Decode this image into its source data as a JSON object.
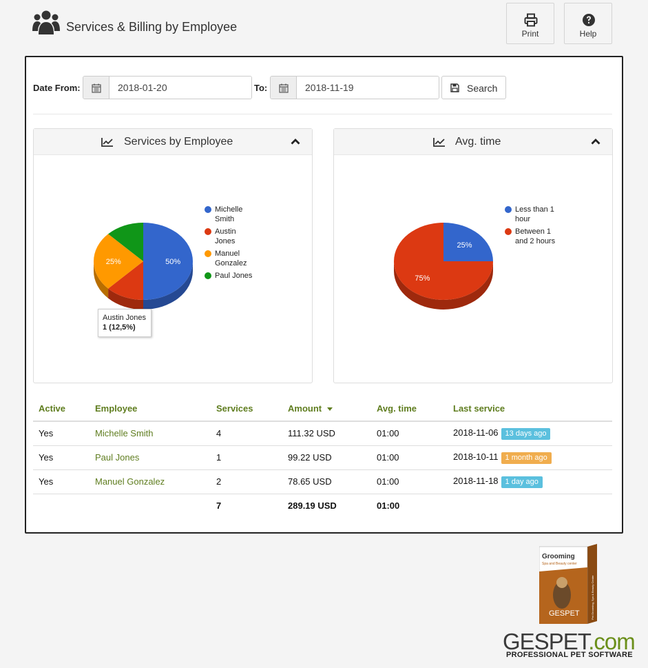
{
  "header": {
    "title": "Services & Billing by Employee",
    "print_label": "Print",
    "help_label": "Help"
  },
  "filters": {
    "date_from_label": "Date From:",
    "date_from_value": "2018-01-20",
    "date_to_label": "To:",
    "date_to_value": "2018-11-19",
    "search_label": "Search"
  },
  "box1": {
    "title": "Services by Employee",
    "legend": [
      "Michelle Smith",
      "Austin Jones",
      "Manuel Gonzalez",
      "Paul Jones"
    ],
    "tooltip_name": "Austin Jones",
    "tooltip_value": "1 (12,5%)"
  },
  "box2": {
    "title": "Avg. time",
    "legend": [
      "Less than 1 hour",
      "Between 1 and 2 hours"
    ]
  },
  "chart_data": [
    {
      "type": "pie",
      "title": "Services by Employee",
      "categories": [
        "Michelle Smith",
        "Austin Jones",
        "Manuel Gonzalez",
        "Paul Jones"
      ],
      "values": [
        50,
        12.5,
        25,
        12.5
      ],
      "labels_shown": [
        "50%",
        "",
        "25%",
        ""
      ],
      "colors": [
        "#3366cc",
        "#dc3912",
        "#ff9900",
        "#109618"
      ],
      "legend_position": "right"
    },
    {
      "type": "pie",
      "title": "Avg. time",
      "categories": [
        "Less than 1 hour",
        "Between 1 and 2 hours"
      ],
      "values": [
        25,
        75
      ],
      "labels_shown": [
        "25%",
        "75%"
      ],
      "colors": [
        "#3366cc",
        "#dc3912"
      ],
      "legend_position": "right"
    }
  ],
  "table": {
    "headers": {
      "active": "Active",
      "employee": "Employee",
      "services": "Services",
      "amount": "Amount",
      "avg_time": "Avg. time",
      "last_service": "Last service"
    },
    "rows": [
      {
        "active": "Yes",
        "employee": "Michelle Smith",
        "services": "4",
        "amount": "111.32 USD",
        "avg_time": "01:00",
        "last_service": "2018-11-06",
        "badge": "13 days ago",
        "badge_color": "#5bc0de"
      },
      {
        "active": "Yes",
        "employee": "Paul Jones",
        "services": "1",
        "amount": "99.22 USD",
        "avg_time": "01:00",
        "last_service": "2018-10-11",
        "badge": "1 month ago",
        "badge_color": "#f0ad4e"
      },
      {
        "active": "Yes",
        "employee": "Manuel Gonzalez",
        "services": "2",
        "amount": "78.65 USD",
        "avg_time": "01:00",
        "last_service": "2018-11-18",
        "badge": "1 day ago",
        "badge_color": "#5bc0de"
      }
    ],
    "totals": {
      "services": "7",
      "amount": "289.19 USD",
      "avg_time": "01:00"
    }
  },
  "branding": {
    "logo_text": "GESPET",
    "logo_suffix": ".com",
    "tagline": "PROFESSIONAL PET SOFTWARE",
    "box_title": "Grooming",
    "box_subtitle": "Spa and Beauty center",
    "box_side_text": "Pet Grooming, Spa & Beauty Center"
  },
  "colors": {
    "accent_green": "#5f7d1f",
    "badge_info": "#5bc0de",
    "badge_warning": "#f0ad4e"
  }
}
